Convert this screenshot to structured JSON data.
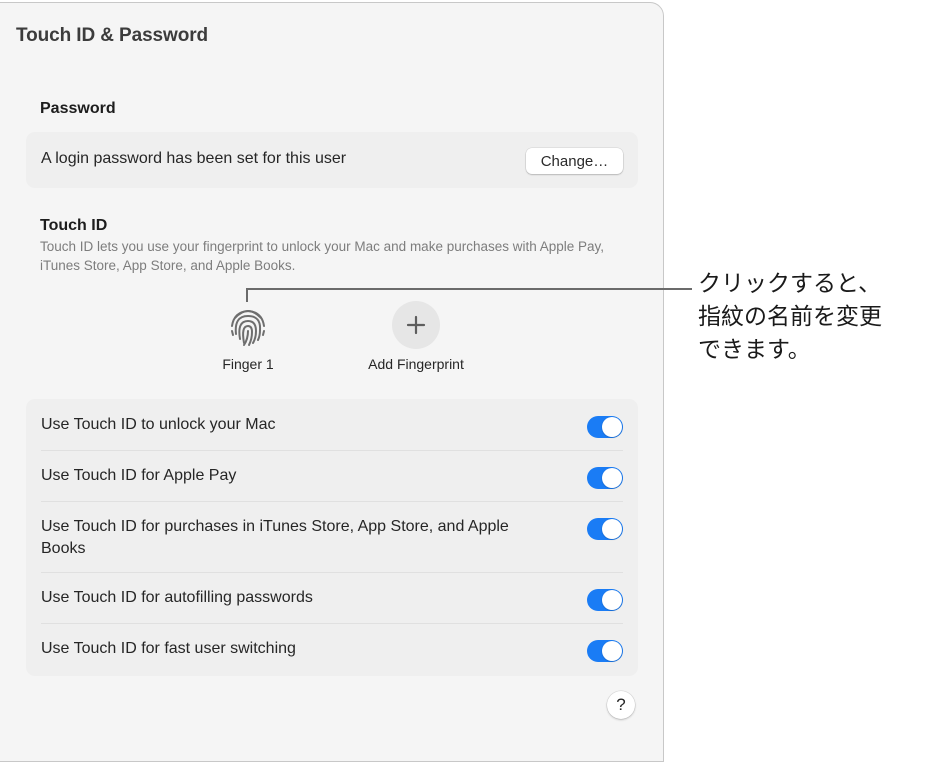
{
  "window": {
    "title": "Touch ID & Password"
  },
  "password": {
    "section_title": "Password",
    "status_text": "A login password has been set for this user",
    "change_button": "Change…"
  },
  "touch_id": {
    "section_title": "Touch ID",
    "description": "Touch ID lets you use your fingerprint to unlock your Mac and make purchases with Apple Pay, iTunes Store, App Store, and Apple Books.",
    "fingerprints": [
      {
        "label": "Finger 1",
        "icon": "fingerprint-icon"
      }
    ],
    "add_fingerprint": {
      "label": "Add Fingerprint",
      "icon": "plus-icon"
    }
  },
  "options": [
    {
      "label": "Use Touch ID to unlock your Mac",
      "enabled": true
    },
    {
      "label": "Use Touch ID for Apple Pay",
      "enabled": true
    },
    {
      "label": "Use Touch ID for purchases in iTunes Store, App Store, and Apple Books",
      "enabled": true
    },
    {
      "label": "Use Touch ID for autofilling passwords",
      "enabled": true
    },
    {
      "label": "Use Touch ID for fast user switching",
      "enabled": true
    }
  ],
  "help_button": "?",
  "accent_color": "#1a7cf5",
  "callout": {
    "text": "クリックすると、\n指紋の名前を変更\nできます。"
  }
}
